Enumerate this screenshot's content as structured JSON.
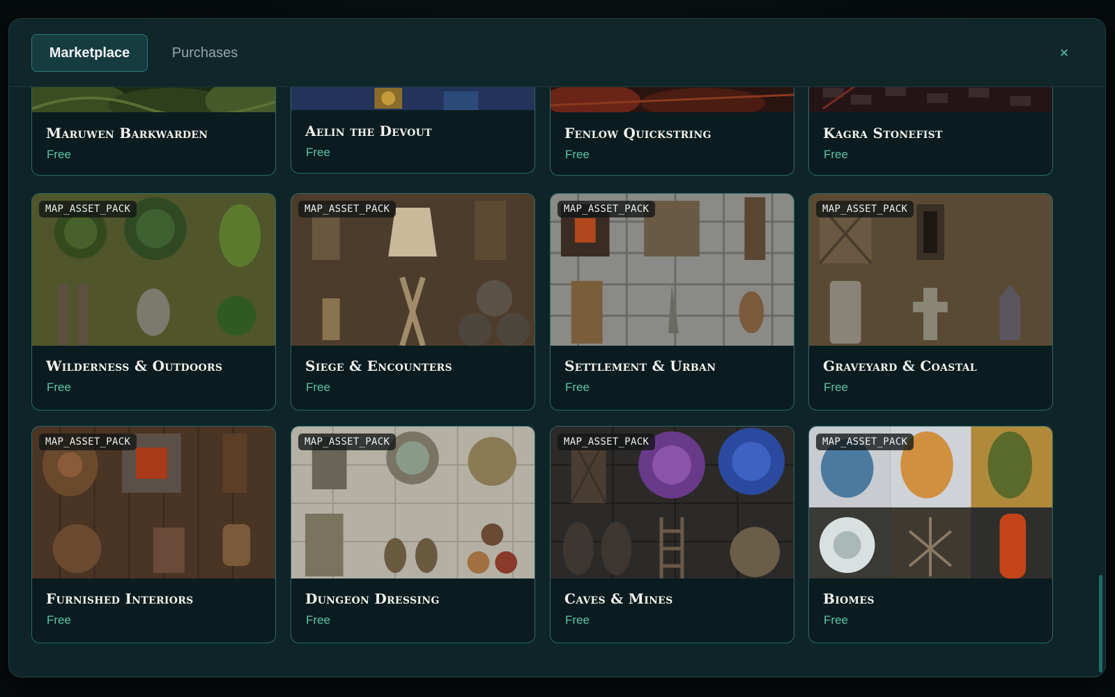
{
  "tabs": [
    {
      "label": "Marketplace",
      "active": true
    },
    {
      "label": "Purchases",
      "active": false
    }
  ],
  "close_icon": "×",
  "colors": {
    "accent": "#5cc6a5",
    "panel": "#0f2427",
    "card_border": "#2b6b6c"
  },
  "cards": [
    {
      "title": "Maruwen Barkwarden",
      "price": "Free",
      "image": "forest-undergrowth-art"
    },
    {
      "title": "Aelin the Devout",
      "price": "Free",
      "image": "armored-cleric-art"
    },
    {
      "title": "Fenlow Quickstring",
      "price": "Free",
      "image": "ember-hued-art"
    },
    {
      "title": "Kagra Stonefist",
      "price": "Free",
      "image": "dark-stone-art"
    },
    {
      "badge": "MAP_ASSET_PACK",
      "title": "Wilderness & Outdoors",
      "price": "Free",
      "image": "trees-bushes-rock-on-grass"
    },
    {
      "badge": "MAP_ASSET_PACK",
      "title": "Siege & Encounters",
      "price": "Free",
      "image": "tent-barricades-barrels-on-dirt"
    },
    {
      "badge": "MAP_ASSET_PACK",
      "title": "Settlement & Urban",
      "price": "Free",
      "image": "forge-loom-door-on-cobblestone"
    },
    {
      "badge": "MAP_ASSET_PACK",
      "title": "Graveyard & Coastal",
      "price": "Free",
      "image": "crypt-gravestones-on-dirt"
    },
    {
      "badge": "MAP_ASSET_PACK",
      "title": "Furnished Interiors",
      "price": "Free",
      "image": "table-brazier-barrels-on-planks"
    },
    {
      "badge": "MAP_ASSET_PACK",
      "title": "Dungeon Dressing",
      "price": "Free",
      "image": "well-statue-urns-on-tiles"
    },
    {
      "badge": "MAP_ASSET_PACK",
      "title": "Caves & Mines",
      "price": "Free",
      "image": "crystals-mine-track-on-rock"
    },
    {
      "badge": "MAP_ASSET_PACK",
      "title": "Biomes",
      "price": "Free",
      "image": "ice-sand-lava-terrain-tiles"
    }
  ]
}
